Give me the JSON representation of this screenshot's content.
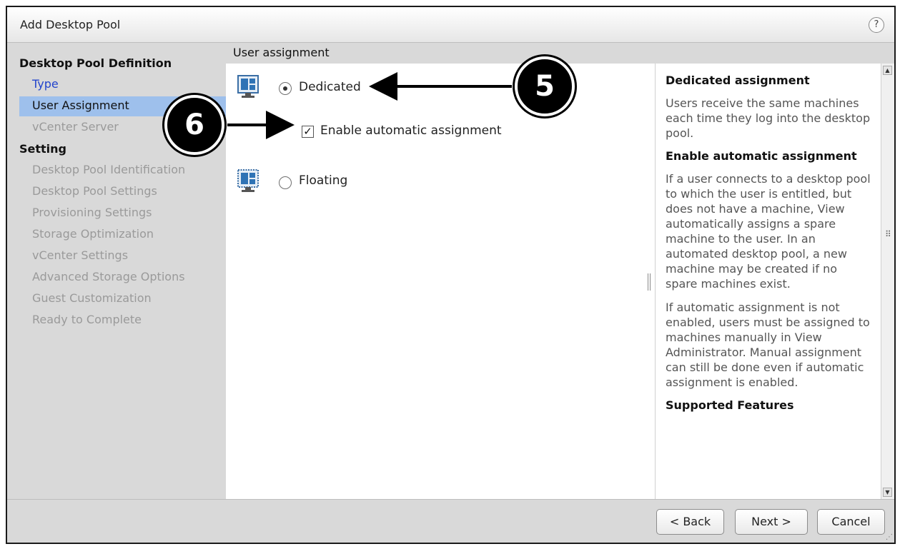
{
  "dialog": {
    "title": "Add Desktop Pool",
    "help_label": "?"
  },
  "nav": {
    "sections": [
      {
        "label": "Desktop Pool Definition",
        "items": [
          {
            "label": "Type",
            "state": "link"
          },
          {
            "label": "User Assignment",
            "state": "selected"
          },
          {
            "label": "vCenter Server",
            "state": "disabled"
          }
        ]
      },
      {
        "label": "Setting",
        "items": [
          {
            "label": "Desktop Pool Identification",
            "state": "disabled"
          },
          {
            "label": "Desktop Pool Settings",
            "state": "disabled"
          },
          {
            "label": "Provisioning Settings",
            "state": "disabled"
          },
          {
            "label": "Storage Optimization",
            "state": "disabled"
          },
          {
            "label": "vCenter Settings",
            "state": "disabled"
          },
          {
            "label": "Advanced Storage Options",
            "state": "disabled"
          },
          {
            "label": "Guest Customization",
            "state": "disabled"
          },
          {
            "label": "Ready to Complete",
            "state": "disabled"
          }
        ]
      }
    ]
  },
  "main": {
    "section_title": "User assignment",
    "options": {
      "dedicated": {
        "label": "Dedicated",
        "selected": true
      },
      "auto_assign": {
        "label": "Enable automatic assignment",
        "checked": true
      },
      "floating": {
        "label": "Floating",
        "selected": false
      }
    }
  },
  "help_panel": {
    "heading1": "Dedicated assignment",
    "para1": "Users receive the same machines each time they log into the desktop pool.",
    "heading2": "Enable automatic assignment",
    "para2": "If a user connects to a desktop pool to which the user is entitled, but does not have a machine, View automatically assigns a spare machine to the user. In an automated desktop pool, a new machine may be created if no spare machines exist.",
    "para3": "If automatic assignment is not enabled, users must be assigned to machines manually in View Administrator. Manual assignment can still be done even if automatic assignment is enabled.",
    "heading3": "Supported Features"
  },
  "footer": {
    "back_label": "< Back",
    "next_label": "Next >",
    "cancel_label": "Cancel"
  },
  "callouts": {
    "five": "5",
    "six": "6"
  },
  "colors": {
    "selected_nav": "#9ec0ec",
    "link": "#2244cc",
    "disabled": "#9a9a9a",
    "icon_blue": "#2f73b5"
  }
}
